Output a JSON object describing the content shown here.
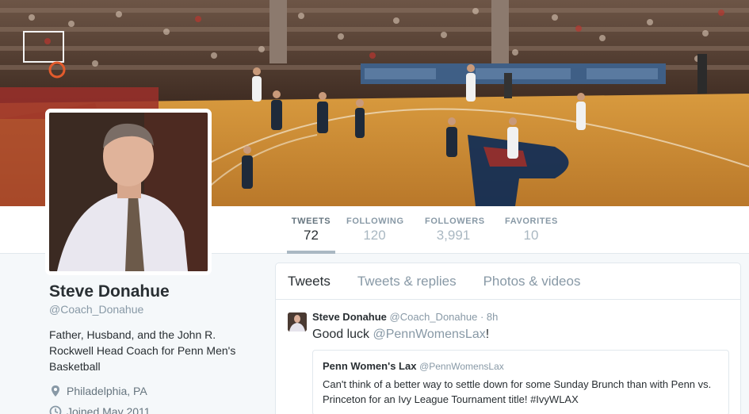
{
  "stats": [
    {
      "label": "TWEETS",
      "value": "72",
      "active": true
    },
    {
      "label": "FOLLOWING",
      "value": "120",
      "active": false
    },
    {
      "label": "FOLLOWERS",
      "value": "3,991",
      "active": false
    },
    {
      "label": "FAVORITES",
      "value": "10",
      "active": false
    }
  ],
  "profile": {
    "name": "Steve Donahue",
    "handle": "@Coach_Donahue",
    "bio": "Father, Husband, and the John R. Rockwell Head Coach for Penn Men's Basketball",
    "location": "Philadelphia, PA",
    "joined": "Joined May 2011"
  },
  "timeline": {
    "tabs": [
      "Tweets",
      "Tweets & replies",
      "Photos & videos"
    ],
    "tweet": {
      "name": "Steve Donahue",
      "handle": "@Coach_Donahue",
      "sep": " · ",
      "time": "8h",
      "text_before": "Good luck ",
      "mention": "@PennWomensLax",
      "text_after": "!",
      "quote": {
        "name": "Penn Women's Lax",
        "handle": "@PennWomensLax",
        "text": "Can't think of a better way to settle down for some Sunday Brunch than with Penn vs. Princeton for an Ivy League Tournament title! #IvyWLAX"
      }
    }
  },
  "colors": {
    "link_muted": "#8899a6",
    "text": "#292f33",
    "border": "#e1e8ed",
    "court": "#c8892f"
  },
  "icons": [
    "location-pin-icon",
    "clock-icon"
  ]
}
